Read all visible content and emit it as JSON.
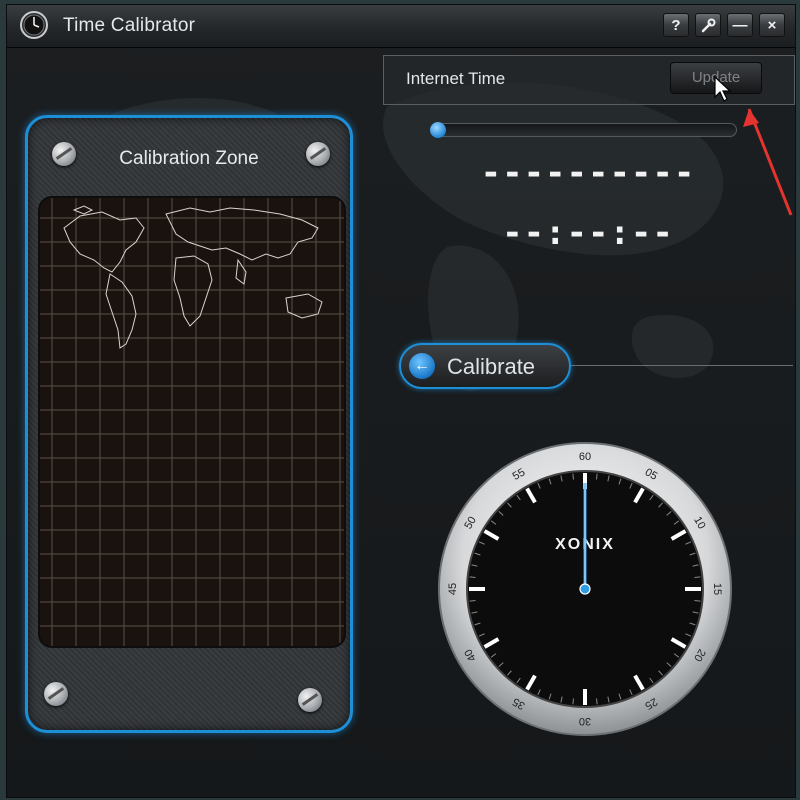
{
  "window": {
    "title": "Time Calibrator",
    "icons": [
      "clock-icon"
    ]
  },
  "titlebar_buttons": [
    {
      "name": "help-button",
      "label": "?"
    },
    {
      "name": "settings-button",
      "icon": "wrench-icon"
    },
    {
      "name": "minimize-button",
      "label": "—"
    },
    {
      "name": "close-button",
      "label": "×"
    }
  ],
  "calibration_zone": {
    "title": "Calibration Zone"
  },
  "internet_time": {
    "label": "Internet Time",
    "update_label": "Update",
    "progress": 0.0
  },
  "display": {
    "date": "----------",
    "time": "--:--:--"
  },
  "calibrate": {
    "label": "Calibrate",
    "icon": "arrow-left-icon"
  },
  "clock": {
    "brand": "XONIX",
    "numbers": [
      "60",
      "05",
      "10",
      "15",
      "20",
      "25",
      "30",
      "35",
      "40",
      "45",
      "50",
      "55"
    ],
    "hand_second": 0
  },
  "colors": {
    "accent": "#1d8fd6",
    "background": "#1c1f21",
    "annotation_arrow": "#e3342f"
  }
}
